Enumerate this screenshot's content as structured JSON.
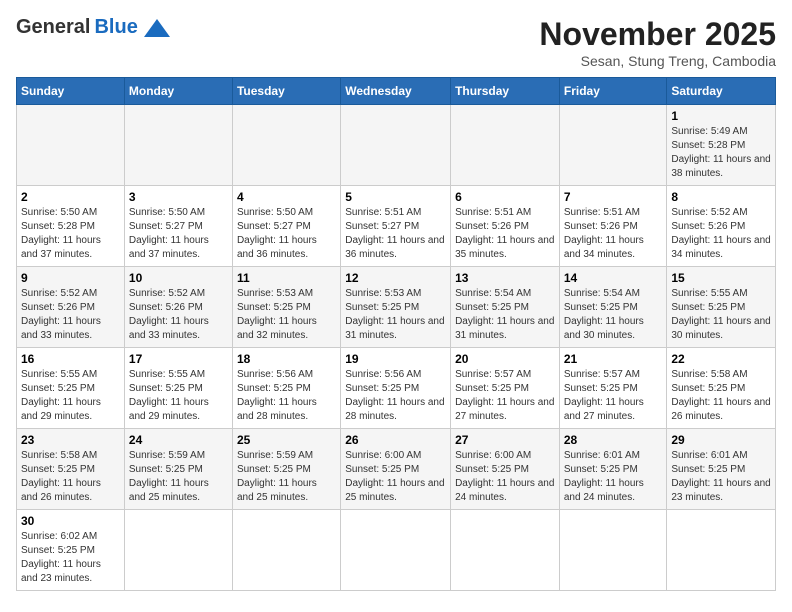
{
  "header": {
    "logo_general": "General",
    "logo_blue": "Blue",
    "main_title": "November 2025",
    "subtitle": "Sesan, Stung Treng, Cambodia"
  },
  "weekdays": [
    "Sunday",
    "Monday",
    "Tuesday",
    "Wednesday",
    "Thursday",
    "Friday",
    "Saturday"
  ],
  "weeks": [
    [
      {
        "day": "",
        "info": ""
      },
      {
        "day": "",
        "info": ""
      },
      {
        "day": "",
        "info": ""
      },
      {
        "day": "",
        "info": ""
      },
      {
        "day": "",
        "info": ""
      },
      {
        "day": "",
        "info": ""
      },
      {
        "day": "1",
        "info": "Sunrise: 5:49 AM\nSunset: 5:28 PM\nDaylight: 11 hours and 38 minutes."
      }
    ],
    [
      {
        "day": "2",
        "info": "Sunrise: 5:50 AM\nSunset: 5:28 PM\nDaylight: 11 hours and 37 minutes."
      },
      {
        "day": "3",
        "info": "Sunrise: 5:50 AM\nSunset: 5:27 PM\nDaylight: 11 hours and 37 minutes."
      },
      {
        "day": "4",
        "info": "Sunrise: 5:50 AM\nSunset: 5:27 PM\nDaylight: 11 hours and 36 minutes."
      },
      {
        "day": "5",
        "info": "Sunrise: 5:51 AM\nSunset: 5:27 PM\nDaylight: 11 hours and 36 minutes."
      },
      {
        "day": "6",
        "info": "Sunrise: 5:51 AM\nSunset: 5:26 PM\nDaylight: 11 hours and 35 minutes."
      },
      {
        "day": "7",
        "info": "Sunrise: 5:51 AM\nSunset: 5:26 PM\nDaylight: 11 hours and 34 minutes."
      },
      {
        "day": "8",
        "info": "Sunrise: 5:52 AM\nSunset: 5:26 PM\nDaylight: 11 hours and 34 minutes."
      }
    ],
    [
      {
        "day": "9",
        "info": "Sunrise: 5:52 AM\nSunset: 5:26 PM\nDaylight: 11 hours and 33 minutes."
      },
      {
        "day": "10",
        "info": "Sunrise: 5:52 AM\nSunset: 5:26 PM\nDaylight: 11 hours and 33 minutes."
      },
      {
        "day": "11",
        "info": "Sunrise: 5:53 AM\nSunset: 5:25 PM\nDaylight: 11 hours and 32 minutes."
      },
      {
        "day": "12",
        "info": "Sunrise: 5:53 AM\nSunset: 5:25 PM\nDaylight: 11 hours and 31 minutes."
      },
      {
        "day": "13",
        "info": "Sunrise: 5:54 AM\nSunset: 5:25 PM\nDaylight: 11 hours and 31 minutes."
      },
      {
        "day": "14",
        "info": "Sunrise: 5:54 AM\nSunset: 5:25 PM\nDaylight: 11 hours and 30 minutes."
      },
      {
        "day": "15",
        "info": "Sunrise: 5:55 AM\nSunset: 5:25 PM\nDaylight: 11 hours and 30 minutes."
      }
    ],
    [
      {
        "day": "16",
        "info": "Sunrise: 5:55 AM\nSunset: 5:25 PM\nDaylight: 11 hours and 29 minutes."
      },
      {
        "day": "17",
        "info": "Sunrise: 5:55 AM\nSunset: 5:25 PM\nDaylight: 11 hours and 29 minutes."
      },
      {
        "day": "18",
        "info": "Sunrise: 5:56 AM\nSunset: 5:25 PM\nDaylight: 11 hours and 28 minutes."
      },
      {
        "day": "19",
        "info": "Sunrise: 5:56 AM\nSunset: 5:25 PM\nDaylight: 11 hours and 28 minutes."
      },
      {
        "day": "20",
        "info": "Sunrise: 5:57 AM\nSunset: 5:25 PM\nDaylight: 11 hours and 27 minutes."
      },
      {
        "day": "21",
        "info": "Sunrise: 5:57 AM\nSunset: 5:25 PM\nDaylight: 11 hours and 27 minutes."
      },
      {
        "day": "22",
        "info": "Sunrise: 5:58 AM\nSunset: 5:25 PM\nDaylight: 11 hours and 26 minutes."
      }
    ],
    [
      {
        "day": "23",
        "info": "Sunrise: 5:58 AM\nSunset: 5:25 PM\nDaylight: 11 hours and 26 minutes."
      },
      {
        "day": "24",
        "info": "Sunrise: 5:59 AM\nSunset: 5:25 PM\nDaylight: 11 hours and 25 minutes."
      },
      {
        "day": "25",
        "info": "Sunrise: 5:59 AM\nSunset: 5:25 PM\nDaylight: 11 hours and 25 minutes."
      },
      {
        "day": "26",
        "info": "Sunrise: 6:00 AM\nSunset: 5:25 PM\nDaylight: 11 hours and 25 minutes."
      },
      {
        "day": "27",
        "info": "Sunrise: 6:00 AM\nSunset: 5:25 PM\nDaylight: 11 hours and 24 minutes."
      },
      {
        "day": "28",
        "info": "Sunrise: 6:01 AM\nSunset: 5:25 PM\nDaylight: 11 hours and 24 minutes."
      },
      {
        "day": "29",
        "info": "Sunrise: 6:01 AM\nSunset: 5:25 PM\nDaylight: 11 hours and 23 minutes."
      }
    ],
    [
      {
        "day": "30",
        "info": "Sunrise: 6:02 AM\nSunset: 5:25 PM\nDaylight: 11 hours and 23 minutes."
      },
      {
        "day": "",
        "info": ""
      },
      {
        "day": "",
        "info": ""
      },
      {
        "day": "",
        "info": ""
      },
      {
        "day": "",
        "info": ""
      },
      {
        "day": "",
        "info": ""
      },
      {
        "day": "",
        "info": ""
      }
    ]
  ]
}
